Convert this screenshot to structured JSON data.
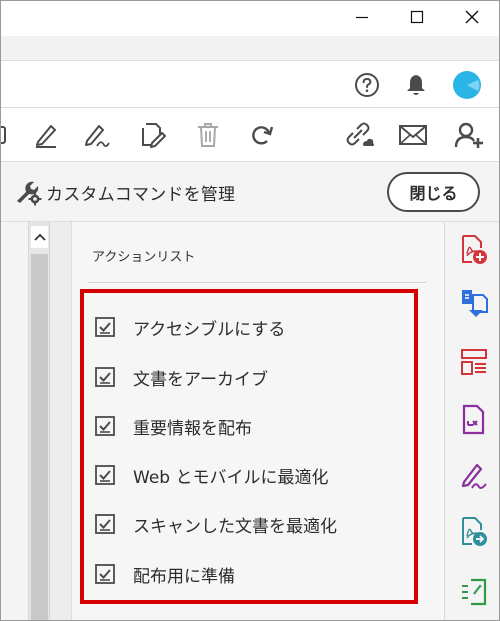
{
  "window": {
    "minimize_icon": "minimize-icon",
    "maximize_icon": "maximize-icon",
    "close_icon": "close-icon"
  },
  "topbar": {
    "icons": [
      "help-icon",
      "bell-icon",
      "account-avatar-icon"
    ]
  },
  "toolbar": {
    "icons": [
      "marker-icon",
      "highlighter-icon",
      "sign-icon",
      "edit-pages-icon",
      "delete-icon",
      "redo-icon",
      "link-share-icon",
      "mail-icon",
      "add-user-icon"
    ]
  },
  "command": {
    "title": "カスタムコマンドを管理",
    "close_label": "閉じる",
    "icon": "wrench-gear-icon"
  },
  "action_list": {
    "heading": "アクションリスト",
    "items": [
      "アクセシブルにする",
      "文書をアーカイブ",
      "重要情報を配布",
      "Web とモバイルに最適化",
      "スキャンした文書を最適化",
      "配布用に準備"
    ]
  },
  "right_rail": {
    "icons": [
      "create-pdf-icon",
      "combine-files-icon",
      "organize-pages-icon",
      "compress-pdf-icon",
      "fill-sign-icon",
      "export-pdf-icon",
      "more-tools-icon"
    ]
  },
  "colors": {
    "highlight": "#d40000",
    "accent_red": "#d4343b",
    "accent_blue": "#2f6fde",
    "accent_purple": "#8a2fa0",
    "accent_green": "#2f9a4a",
    "avatar": "#2bb4e6"
  }
}
